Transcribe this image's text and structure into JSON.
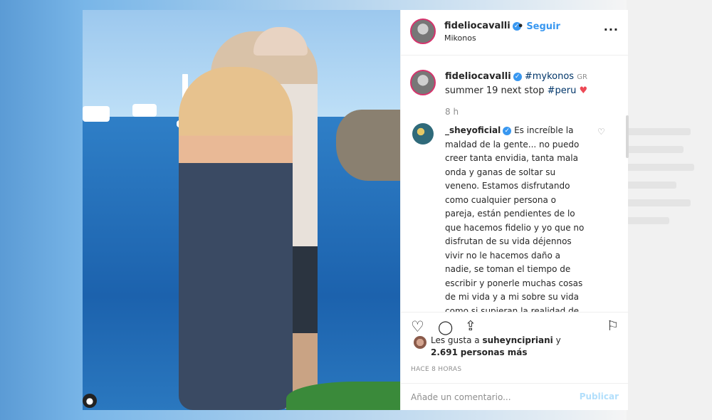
{
  "post": {
    "username": "fideliocavalli",
    "follow_label": "Seguir",
    "location": "Mikonos",
    "more_icon": "more-horizontal-icon",
    "caption": {
      "username": "fideliocavalli",
      "hashtag1": "#mykonos",
      "flag": "GR",
      "text": "summer 19 next stop",
      "hashtag2": "#peru",
      "emoji": "♥"
    },
    "caption_time": "8 h",
    "comment": {
      "username": "_sheyoficial",
      "text": "Es increíble la maldad de la gente... no puedo creer tanta envidia, tanta mala onda y ganas de soltar su veneno. Estamos disfrutando como cualquier persona o pareja, están pendientes de lo que hacemos fidelio y yo que no disfrutan de su vida déjennos vivir no le hacemos daño a nadie, se toman el tiempo de escribir y ponerle muchas cosas de mi vida y a mi sobre su vida como si supieran la realidad de las cosas, gracias por tu tiempo pero en"
    },
    "likes": {
      "prefix": "Les gusta a",
      "user": "suheyncipriani",
      "connector": "y",
      "count": "2.691",
      "suffix": "personas más"
    },
    "time_ago": "HACE 8 HORAS",
    "add_comment_placeholder": "Añade un comentario...",
    "publish_label": "Publicar"
  },
  "colors": {
    "accent": "#3897f0",
    "text": "#262626",
    "muted": "#8e8e8e",
    "heart": "#ed4956"
  }
}
